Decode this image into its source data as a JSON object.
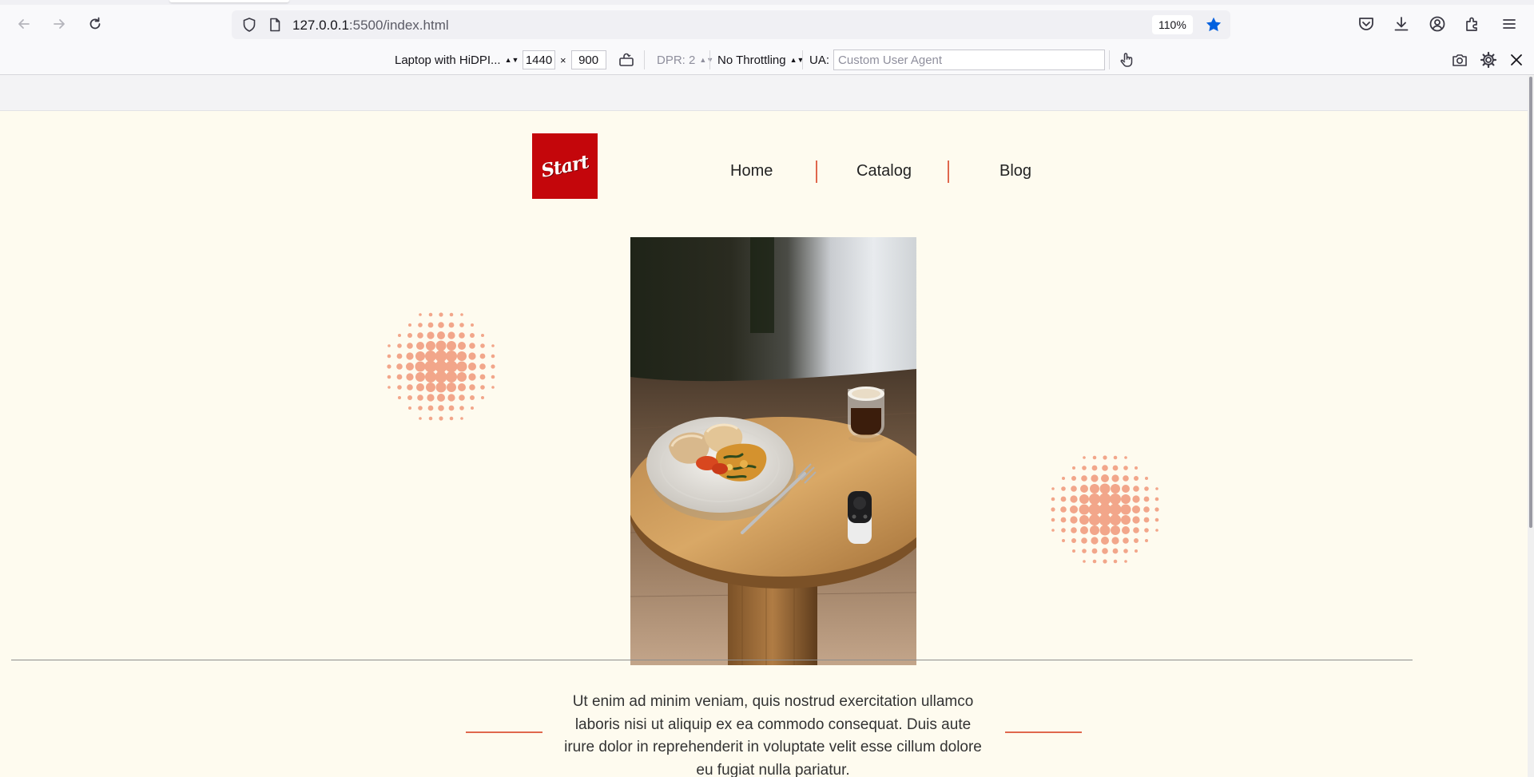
{
  "browser": {
    "url": {
      "host": "127.0.0.1",
      "path": ":5500/index.html"
    },
    "zoom": "110%",
    "icons": {
      "back": "arrow-left-icon",
      "forward": "arrow-right-icon",
      "reload": "reload-icon",
      "tracking": "shield-icon",
      "page": "page-icon",
      "bookmark": "star-icon",
      "pocket": "pocket-icon",
      "downloads": "download-icon",
      "account": "account-icon",
      "extensions": "extensions-icon",
      "menu": "hamburger-menu-icon"
    }
  },
  "rdm": {
    "device": "Laptop with HiDPI...",
    "width": "1440",
    "times": "×",
    "height": "900",
    "dpr": "DPR: 2",
    "throttling": "No Throttling",
    "ua_label": "UA:",
    "ua_placeholder": "Custom User Agent",
    "icons": {
      "rotate": "rotate-icon",
      "touch": "touch-icon",
      "screenshot": "camera-icon",
      "settings": "gear-icon",
      "close": "close-icon"
    }
  },
  "site": {
    "logo_text": "Start",
    "nav": [
      "Home",
      "Catalog",
      "Blog"
    ],
    "hero_text": "Ut enim ad minim veniam, quis nostrud exercitation ullamco laboris nisi ut aliquip ex ea commodo consequat. Duis aute irure dolor in reprehenderit in voluptate velit esse cillum dolore eu fugiat nulla pariatur.",
    "colors": {
      "accent": "#e0674d",
      "logo_bg": "#c4060b",
      "page_bg": "#fefbef",
      "halftone": "#f2a68a"
    }
  }
}
